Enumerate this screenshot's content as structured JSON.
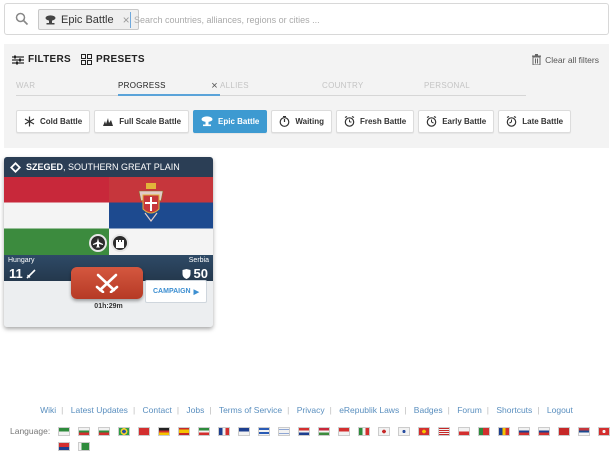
{
  "search": {
    "chip_label": "Epic Battle",
    "chip_close": "×",
    "placeholder": "Search countries, alliances, regions or cities ..."
  },
  "filters": {
    "filters_label": "FILTERS",
    "presets_label": "PRESETS",
    "clear_all": "Clear all filters",
    "tabs": [
      {
        "label": "WAR",
        "active": false
      },
      {
        "label": "PROGRESS",
        "active": true,
        "close": "×"
      },
      {
        "label": "ALLIES",
        "active": false
      },
      {
        "label": "COUNTRY",
        "active": false
      },
      {
        "label": "PERSONAL",
        "active": false
      }
    ],
    "progress_options": [
      {
        "label": "Cold Battle",
        "icon": "snowflake-icon",
        "active": false
      },
      {
        "label": "Full Scale Battle",
        "icon": "explosion-icon",
        "active": false
      },
      {
        "label": "Epic Battle",
        "icon": "mushroom-cloud-icon",
        "active": true
      },
      {
        "label": "Waiting",
        "icon": "timer-icon",
        "active": false
      },
      {
        "label": "Fresh Battle",
        "icon": "alarm-clock-icon",
        "active": false
      },
      {
        "label": "Early Battle",
        "icon": "alarm-clock-icon",
        "active": false
      },
      {
        "label": "Late Battle",
        "icon": "alarm-clock-icon",
        "active": false
      }
    ]
  },
  "battle_card": {
    "region": "SZEGED",
    "area": ", SOUTHERN GREAT PLAIN",
    "left_country": "Hungary",
    "right_country": "Serbia",
    "left_score": "11",
    "right_score": "50",
    "timer": "01h:29m",
    "campaign_label": "CAMPAIGN",
    "campaign_arrow": "▶"
  },
  "footer": {
    "links": [
      "Wiki",
      "Latest Updates",
      "Contact",
      "Jobs",
      "Terms of Service",
      "Privacy",
      "eRepublik Laws",
      "Badges",
      "Forum",
      "Shortcuts",
      "Logout"
    ],
    "language_label": "Language:"
  },
  "colors": {
    "accent": "#3d9ad1",
    "card_header": "#2b3e55",
    "fight_button": "#c44a34",
    "link": "#5a8fbf"
  }
}
